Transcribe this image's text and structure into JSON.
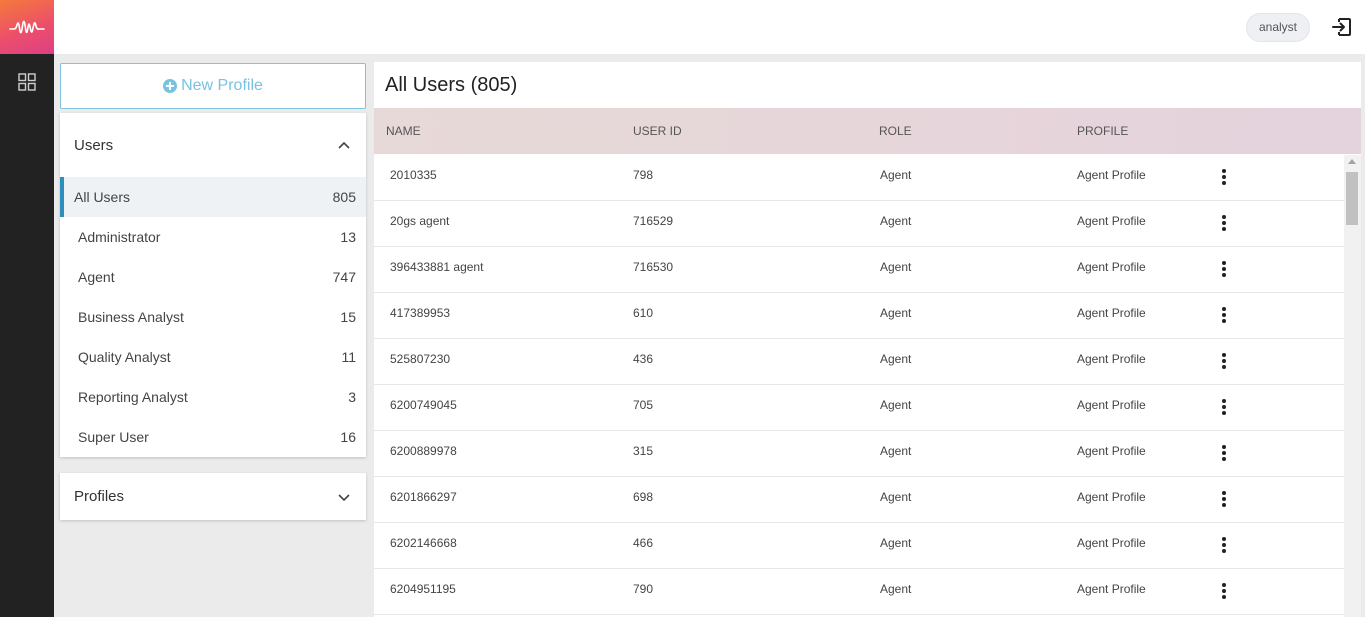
{
  "topbar": {
    "user": "analyst"
  },
  "sidebar": {
    "new_profile_label": "New Profile",
    "users_panel": {
      "title": "Users",
      "items": [
        {
          "label": "All Users",
          "count": "805"
        },
        {
          "label": "Administrator",
          "count": "13"
        },
        {
          "label": "Agent",
          "count": "747"
        },
        {
          "label": "Business Analyst",
          "count": "15"
        },
        {
          "label": "Quality Analyst",
          "count": "11"
        },
        {
          "label": "Reporting Analyst",
          "count": "3"
        },
        {
          "label": "Super User",
          "count": "16"
        }
      ]
    },
    "profiles_panel": {
      "title": "Profiles"
    }
  },
  "main": {
    "title": "All Users (805)",
    "columns": [
      "NAME",
      "USER ID",
      "ROLE",
      "PROFILE"
    ],
    "rows": [
      {
        "name": "2010335",
        "user_id": "798",
        "role": "Agent",
        "profile": "Agent Profile"
      },
      {
        "name": "20gs agent",
        "user_id": "716529",
        "role": "Agent",
        "profile": "Agent Profile"
      },
      {
        "name": "396433881 agent",
        "user_id": "716530",
        "role": "Agent",
        "profile": "Agent Profile"
      },
      {
        "name": "417389953",
        "user_id": "610",
        "role": "Agent",
        "profile": "Agent Profile"
      },
      {
        "name": "525807230",
        "user_id": "436",
        "role": "Agent",
        "profile": "Agent Profile"
      },
      {
        "name": "6200749045",
        "user_id": "705",
        "role": "Agent",
        "profile": "Agent Profile"
      },
      {
        "name": "6200889978",
        "user_id": "315",
        "role": "Agent",
        "profile": "Agent Profile"
      },
      {
        "name": "6201866297",
        "user_id": "698",
        "role": "Agent",
        "profile": "Agent Profile"
      },
      {
        "name": "6202146668",
        "user_id": "466",
        "role": "Agent",
        "profile": "Agent Profile"
      },
      {
        "name": "6204951195",
        "user_id": "790",
        "role": "Agent",
        "profile": "Agent Profile"
      }
    ]
  },
  "colors": {
    "accent": "#2f8fbc",
    "new_profile": "#78c3e0",
    "header_row": "#e6d6da",
    "rail": "#222222"
  },
  "icons": {
    "logo": "waveform-logo-icon",
    "grid": "grid-icon",
    "logout": "logout-icon",
    "add": "plus-circle-icon",
    "collapse": "chevron-up-icon",
    "expand": "chevron-down-icon",
    "row_menu": "kebab-menu-icon"
  }
}
